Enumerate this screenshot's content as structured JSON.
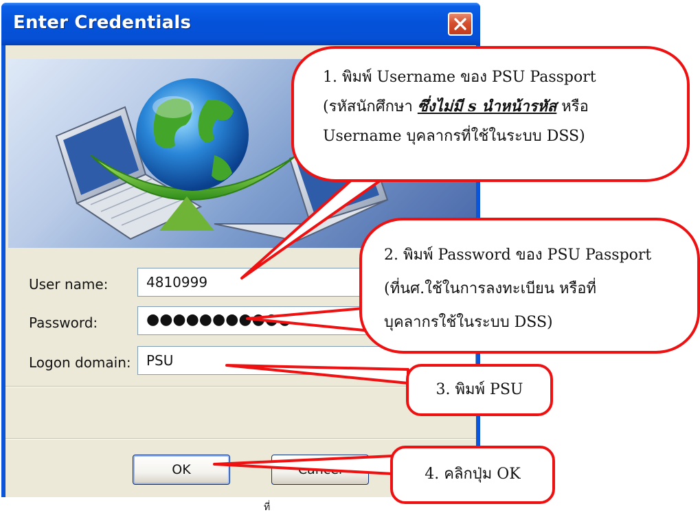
{
  "dialog": {
    "title": "Enter Credentials",
    "fields": {
      "username_label": "User name:",
      "username_value": "4810999",
      "password_label": "Password:",
      "password_value": "●●●●●●●●●●●",
      "domain_label": "Logon domain:",
      "domain_value": "PSU"
    },
    "buttons": {
      "ok": "OK",
      "cancel": "Cancel"
    }
  },
  "annotations": {
    "step1": {
      "line1": "1. พิมพ์ Username ของ PSU Passport",
      "line2_pre": "(รหัสนักศึกษา ",
      "line2_em": "ซึ่งไม่มี s นำหน้ารหัส",
      "line2_post": " หรือ",
      "line3": "Username บุคลากรที่ใช้ในระบบ DSS)"
    },
    "step2": {
      "line1": "2. พิมพ์ Password ของ PSU Passport",
      "line2": "(ที่นศ.ใช้ในการลงทะเบียน หรือที่",
      "line3": "บุคลากรใช้ในระบบ DSS)"
    },
    "step3": "3. พิมพ์ PSU",
    "step4": "4. คลิกปุ่ม OK"
  },
  "footer_text": "ที่",
  "colors": {
    "titlebar": "#0552da",
    "client_bg": "#ece9d8",
    "callout_border": "#ee1111",
    "close_button": "#d4502f"
  },
  "icons": [
    "close-icon",
    "network-globe-illustration",
    "laptop-icon"
  ]
}
